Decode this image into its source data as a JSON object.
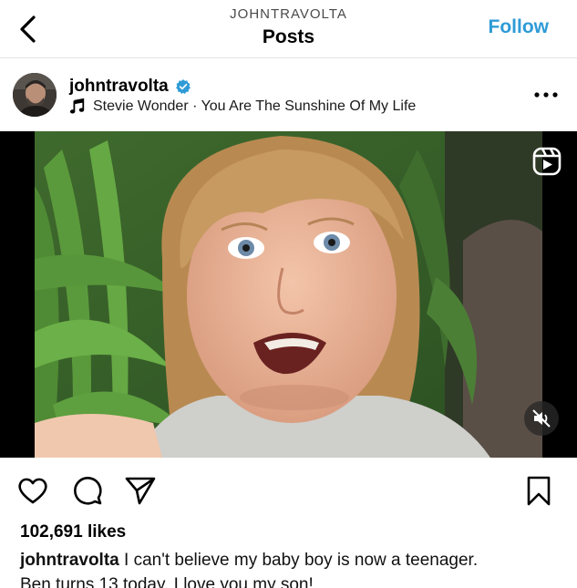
{
  "header": {
    "username_upper": "JOHNTRAVOLTA",
    "title": "Posts",
    "follow_label": "Follow"
  },
  "post": {
    "username": "johntravolta",
    "verified": true,
    "audio": "Stevie Wonder · You Are The Sunshine Of My Life",
    "likes": "102,691 likes",
    "caption_user": "johntravolta",
    "caption_line1": " I can't believe my baby boy is now a teenager.",
    "caption_line2": "Ben turns 13 today. I love you my son!"
  },
  "icons": {
    "back": "chevron-left-icon",
    "verified": "verified-badge-icon",
    "music": "music-note-icon",
    "more": "more-options-icon",
    "reel": "reel-icon",
    "mute": "muted-speaker-icon",
    "like": "heart-icon",
    "comment": "comment-icon",
    "share": "send-icon",
    "save": "bookmark-icon"
  },
  "colors": {
    "follow": "#2e9bd6",
    "verified_badge": "#2e9bd6"
  }
}
